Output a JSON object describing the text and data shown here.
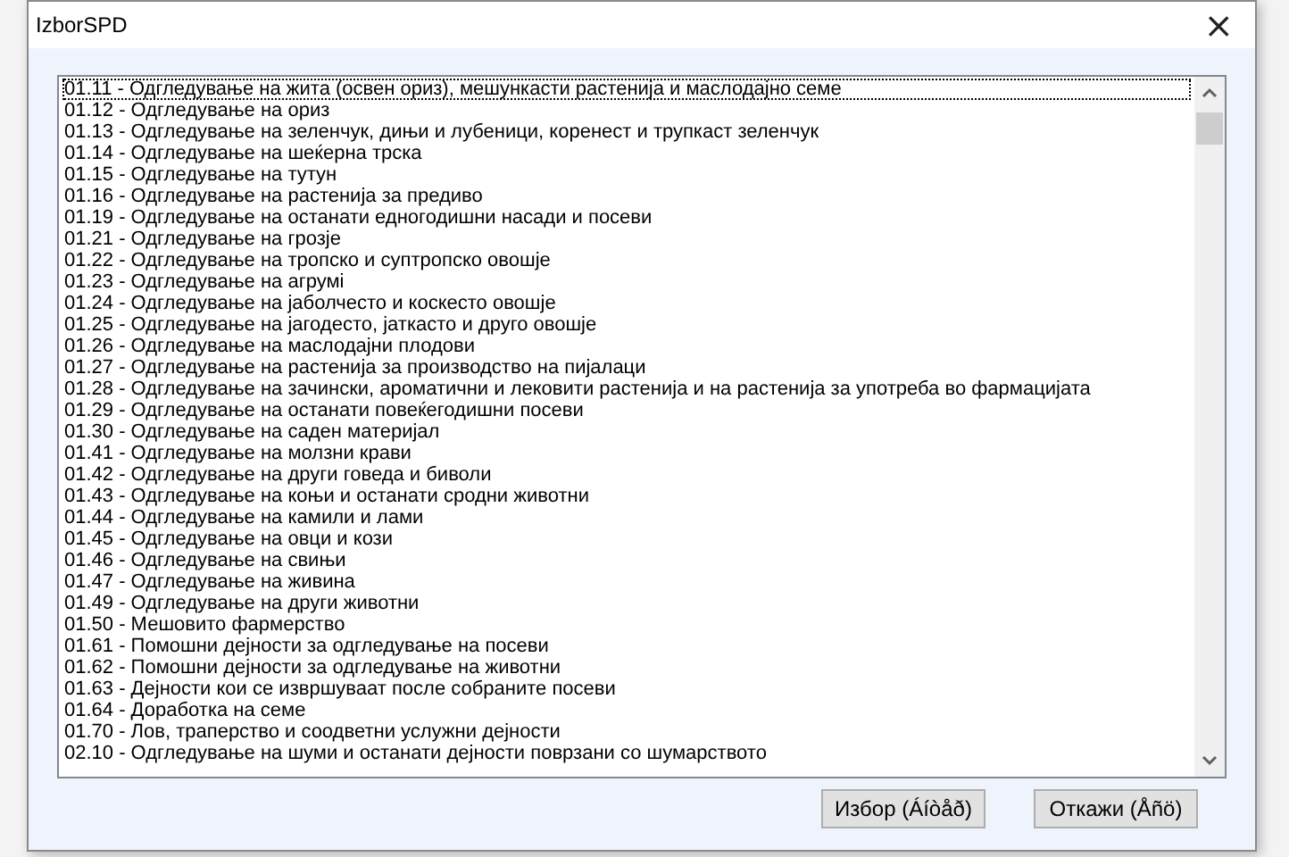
{
  "window": {
    "title": "IzborSPD",
    "close": "×"
  },
  "list": {
    "items": [
      {
        "text": "01.11 - Одгледување на жита (освен ориз), мешункасти растенија и маслодајно семе",
        "selected": true
      },
      {
        "text": "01.12 - Одгледување на ориз",
        "selected": false
      },
      {
        "text": "01.13 - Одгледување на зеленчук, дињи и лубеници, коренест и трупкаст зеленчук",
        "selected": false
      },
      {
        "text": "01.14 - Одгледување на шеќерна трска",
        "selected": false
      },
      {
        "text": "01.15 - Одгледување на тутун",
        "selected": false
      },
      {
        "text": "01.16 - Одгледување на растенија за предиво",
        "selected": false
      },
      {
        "text": "01.19 - Одгледување на останати едногодишни насади и посеви",
        "selected": false
      },
      {
        "text": "01.21 - Одгледување на грозје",
        "selected": false
      },
      {
        "text": "01.22 - Одгледување на тропско и суптропско овошје",
        "selected": false
      },
      {
        "text": "01.23 - Одгледување на агрумі",
        "selected": false
      },
      {
        "text": "01.24 - Одгледување на јаболчесто и коскесто овошје",
        "selected": false
      },
      {
        "text": "01.25 - Одгледување на јагодесто, јаткасто и друго овошје",
        "selected": false
      },
      {
        "text": "01.26 - Одгледување на маслодајни плодови",
        "selected": false
      },
      {
        "text": "01.27 - Одгледување на растенија за производство на пијалаци",
        "selected": false
      },
      {
        "text": "01.28 - Одгледување на зачински, ароматични и лековити растенија и на растенија за употреба во фармацијата",
        "selected": false
      },
      {
        "text": "01.29 - Одгледување на останати повеќегодишни посеви",
        "selected": false
      },
      {
        "text": "01.30 - Одгледување на саден материјал",
        "selected": false
      },
      {
        "text": "01.41 - Одгледување на молзни крави",
        "selected": false
      },
      {
        "text": "01.42 - Одгледување на други говеда и биволи",
        "selected": false
      },
      {
        "text": "01.43 - Одгледување на коњи и останати сродни животни",
        "selected": false
      },
      {
        "text": "01.44 - Одгледување на камили и лами",
        "selected": false
      },
      {
        "text": "01.45 - Одгледување на овци и кози",
        "selected": false
      },
      {
        "text": "01.46 - Одгледување на свињи",
        "selected": false
      },
      {
        "text": "01.47 - Одгледување на живина",
        "selected": false
      },
      {
        "text": "01.49 - Одгледување на други животни",
        "selected": false
      },
      {
        "text": "01.50 - Мешовито фармерство",
        "selected": false
      },
      {
        "text": "01.61 - Помошни дејности за одгледување на посеви",
        "selected": false
      },
      {
        "text": "01.62 - Помошни дејности за одгледување на животни",
        "selected": false
      },
      {
        "text": "01.63 - Дејности кои се извршуваат после собраните посеви",
        "selected": false
      },
      {
        "text": "01.64 - Доработка на семе",
        "selected": false
      },
      {
        "text": "01.70 - Лов, траперство и соодветни услужни дејности",
        "selected": false
      },
      {
        "text": "02.10 - Одгледување на шуми и останати дејности поврзани со шумарството",
        "selected": false
      }
    ]
  },
  "buttons": [
    "Избор (Áíòåð)",
    "Откажи (Åñö)"
  ]
}
